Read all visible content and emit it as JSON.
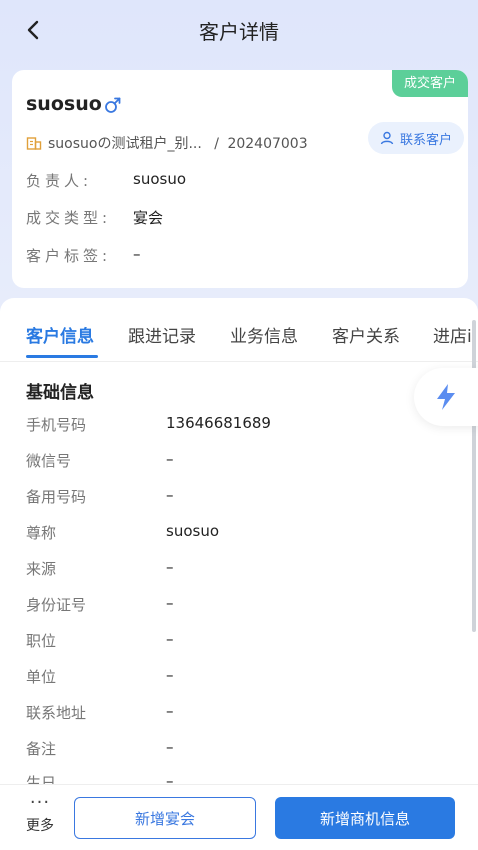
{
  "header": {
    "title": "客户详情"
  },
  "customer": {
    "status_badge": "成交客户",
    "name": "suosuo",
    "shop": "suosuoの测试租户_别...",
    "shop_separator": "/",
    "shop_code": "202407003",
    "contact_button": "联系客户",
    "rows": [
      {
        "label": "负责人:",
        "value": "suosuo"
      },
      {
        "label": "成交类型:",
        "value": "宴会"
      },
      {
        "label": "客户标签:",
        "value": "–"
      }
    ]
  },
  "tabs": [
    "客户信息",
    "跟进记录",
    "业务信息",
    "客户关系",
    "进店i"
  ],
  "basic_info": {
    "title": "基础信息",
    "fields": [
      {
        "label": "手机号码",
        "value": "13646681689"
      },
      {
        "label": "微信号",
        "value": "–"
      },
      {
        "label": "备用号码",
        "value": "–"
      },
      {
        "label": "尊称",
        "value": "suosuo"
      },
      {
        "label": "来源",
        "value": "–"
      },
      {
        "label": "身份证号",
        "value": "–"
      },
      {
        "label": "职位",
        "value": "–"
      },
      {
        "label": "单位",
        "value": "–"
      },
      {
        "label": "联系地址",
        "value": "–"
      },
      {
        "label": "备注",
        "value": "–"
      },
      {
        "label": "生日",
        "value": "–"
      }
    ]
  },
  "bottom": {
    "more_dots": "···",
    "more_label": "更多",
    "add_banquet": "新增宴会",
    "new_info": "新增商机信息"
  },
  "colors": {
    "accent": "#2a7ae2",
    "status_green": "#5ccf99"
  }
}
